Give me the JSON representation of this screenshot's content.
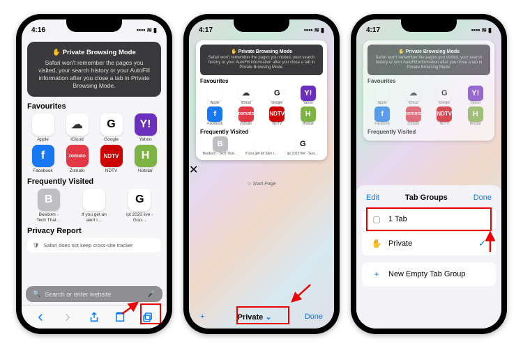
{
  "status": {
    "time1": "4:16",
    "time2": "4:17",
    "time3": "4:17",
    "signal": "▪▪▪▪",
    "wifi": "≋",
    "battery": "▮"
  },
  "banner": {
    "title": "✋ Private Browsing Mode",
    "body": "Safari won't remember the pages you visited, your search history or your AutoFill information after you close a tab in Private Browsing Mode."
  },
  "sections": {
    "fav": "Favourites",
    "freq": "Frequently Visited",
    "privacy": "Privacy Report"
  },
  "fav": [
    {
      "label": "Apple",
      "cls": "apple",
      "glyph": ""
    },
    {
      "label": "iCloud",
      "cls": "icloud",
      "glyph": "☁"
    },
    {
      "label": "Google",
      "cls": "google",
      "glyph": "G"
    },
    {
      "label": "Yahoo",
      "cls": "yahoo",
      "glyph": "Y!"
    },
    {
      "label": "Facebook",
      "cls": "facebook",
      "glyph": "f"
    },
    {
      "label": "Zomato",
      "cls": "zomato",
      "glyph": "zomato"
    },
    {
      "label": "NDTV",
      "cls": "ndtv",
      "glyph": "NDTV"
    },
    {
      "label": "Hotstar",
      "cls": "hotstar",
      "glyph": "H"
    }
  ],
  "freq": [
    {
      "label": "Beebom - Tech That…",
      "cls": "grey",
      "glyph": "B"
    },
    {
      "label": "If you get an alert i…",
      "cls": "apple",
      "glyph": ""
    },
    {
      "label": "ipl 2023 live - Goo…",
      "cls": "google",
      "glyph": "G"
    }
  ],
  "search": {
    "placeholder": "Search or enter website"
  },
  "privacyRow": "Safari does not keep cross-site tracker",
  "startpage": "☆ Start Page",
  "bb": {
    "plus": "+",
    "center": "Private",
    "chevron": "⌄",
    "done": "Done"
  },
  "sheet": {
    "edit": "Edit",
    "title": "Tab Groups",
    "done": "Done",
    "rows": [
      {
        "icon": "▢",
        "label": "1 Tab",
        "checked": false
      },
      {
        "icon": "✋",
        "label": "Private",
        "checked": true
      }
    ],
    "new": {
      "icon": "+",
      "label": "New Empty Tab Group"
    }
  }
}
